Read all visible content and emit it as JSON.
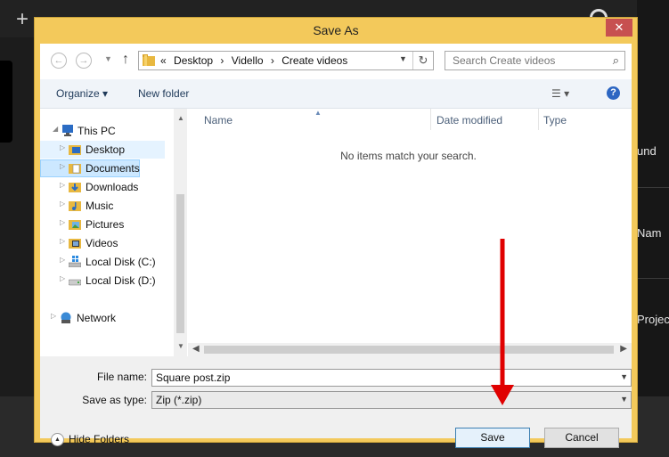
{
  "background_app": {
    "labels": [
      "und",
      "Nam",
      "Projec"
    ]
  },
  "dialog": {
    "title": "Save As",
    "close_glyph": "✕",
    "address": {
      "prefix": "«",
      "crumbs": [
        "Desktop",
        "Vidello",
        "Create videos"
      ],
      "separator": "›"
    },
    "search": {
      "placeholder": "Search Create videos"
    },
    "toolbar": {
      "organize": "Organize ▾",
      "new_folder": "New folder",
      "help": "?"
    },
    "nav_tree": [
      {
        "label": "This PC",
        "icon": "computer-icon"
      },
      {
        "label": "Desktop",
        "icon": "desktop-folder-icon"
      },
      {
        "label": "Documents",
        "icon": "documents-folder-icon",
        "selected": true
      },
      {
        "label": "Downloads",
        "icon": "downloads-folder-icon"
      },
      {
        "label": "Music",
        "icon": "music-folder-icon"
      },
      {
        "label": "Pictures",
        "icon": "pictures-folder-icon"
      },
      {
        "label": "Videos",
        "icon": "videos-folder-icon"
      },
      {
        "label": "Local Disk (C:)",
        "icon": "windows-drive-icon"
      },
      {
        "label": "Local Disk (D:)",
        "icon": "drive-icon"
      },
      {
        "label": "Network",
        "icon": "network-icon"
      }
    ],
    "columns": [
      "Name",
      "Date modified",
      "Type"
    ],
    "empty_message": "No items match your search.",
    "file_name_label": "File name:",
    "file_name_value": "Square post.zip",
    "save_type_label": "Save as type:",
    "save_type_value": "Zip (*.zip)",
    "hide_folders": "Hide Folders",
    "save_button": "Save",
    "cancel_button": "Cancel"
  },
  "colors": {
    "dialog_frame": "#f3c95b",
    "close_button": "#c75050",
    "annotation_arrow": "#e00000",
    "selection": "#cce8ff"
  }
}
